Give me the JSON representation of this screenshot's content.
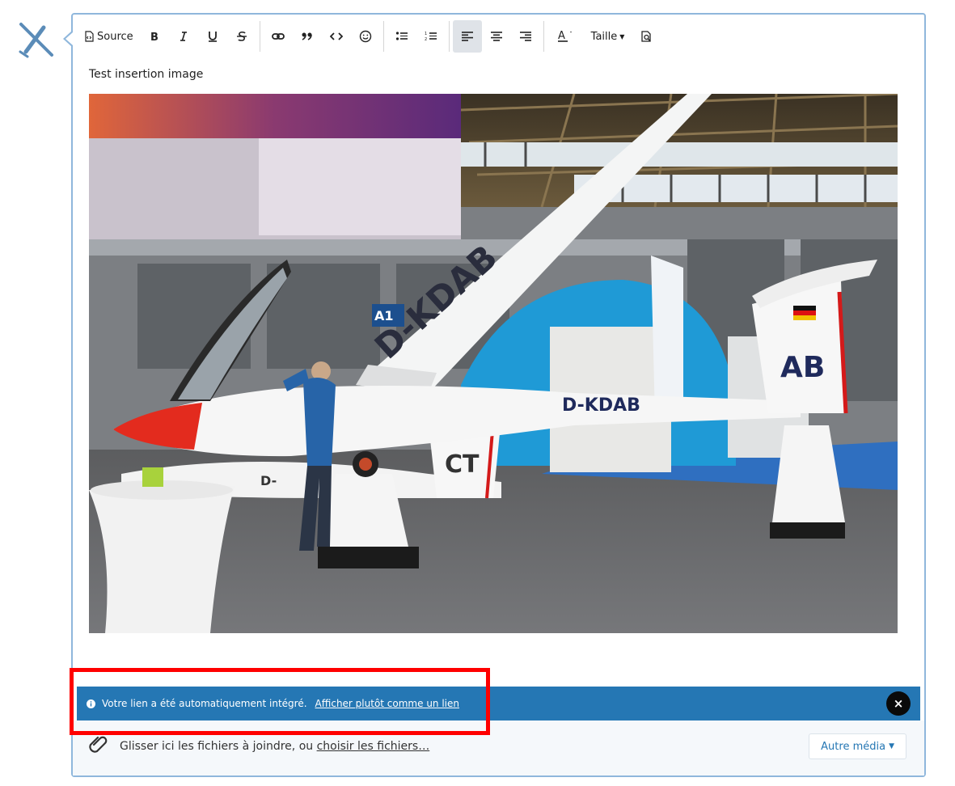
{
  "toolbar": {
    "source_label": "Source",
    "taille_label": "Taille",
    "icons": [
      "source-icon",
      "bold-icon",
      "italic-icon",
      "underline-icon",
      "strikethrough-icon",
      "link-icon",
      "quote-icon",
      "code-icon",
      "emoji-icon",
      "bullet-list-icon",
      "numbered-list-icon",
      "align-left-icon",
      "align-center-icon",
      "align-right-icon",
      "text-color-icon",
      "font-size-icon",
      "preview-icon"
    ]
  },
  "content": {
    "text": "Test insertion image"
  },
  "photo": {
    "wing_registration": "D-KDAB",
    "fuselage_registration": "D-KDAB",
    "tail_code": "AB",
    "second_glider_code": "CT",
    "second_glider_reg": "D-",
    "hall_sign": "A1"
  },
  "notice": {
    "message": "Votre lien a été automatiquement intégré.",
    "link": "Afficher plutôt comme un lien",
    "close": "×"
  },
  "attachments": {
    "text": "Glisser ici les fichiers à joindre, ou ",
    "link": "choisir les fichiers…",
    "media_button": "Autre média"
  },
  "colors": {
    "notice_bg": "#2577b4",
    "editor_border": "#8fb7dc",
    "highlight": "#ff0000"
  }
}
